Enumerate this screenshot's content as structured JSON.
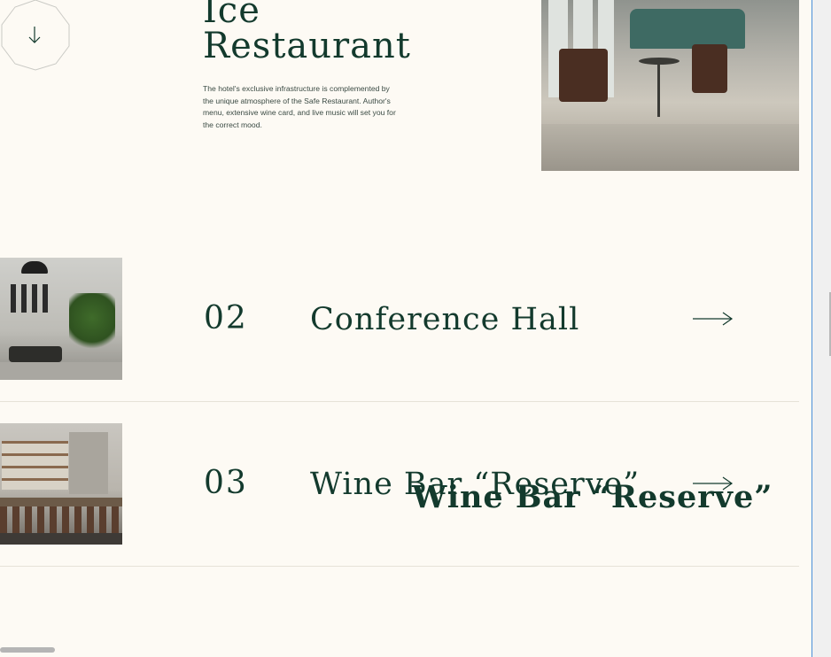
{
  "hero": {
    "title_line1": "Ice",
    "title_line2": "Restaurant",
    "description": "The hotel's exclusive infrastructure is complemented by the unique atmosphere of the Safe Restaurant. Author's menu, extensive wine card, and live music will set you for the correct mood."
  },
  "icons": {
    "scroll_down": "arrow-down-icon",
    "row_arrow": "arrow-right-icon"
  },
  "rows": [
    {
      "number": "02",
      "title": "Conference Hall"
    },
    {
      "number": "03",
      "title": "Wine Bar “Reserve”"
    }
  ],
  "drag_ghost_title": "Wine Bar “Reserve”",
  "colors": {
    "background": "#fdfaf4",
    "text_dark_green": "#133a2d",
    "divider": "#e6e2d8",
    "focus_rule": "#4a90d9"
  }
}
